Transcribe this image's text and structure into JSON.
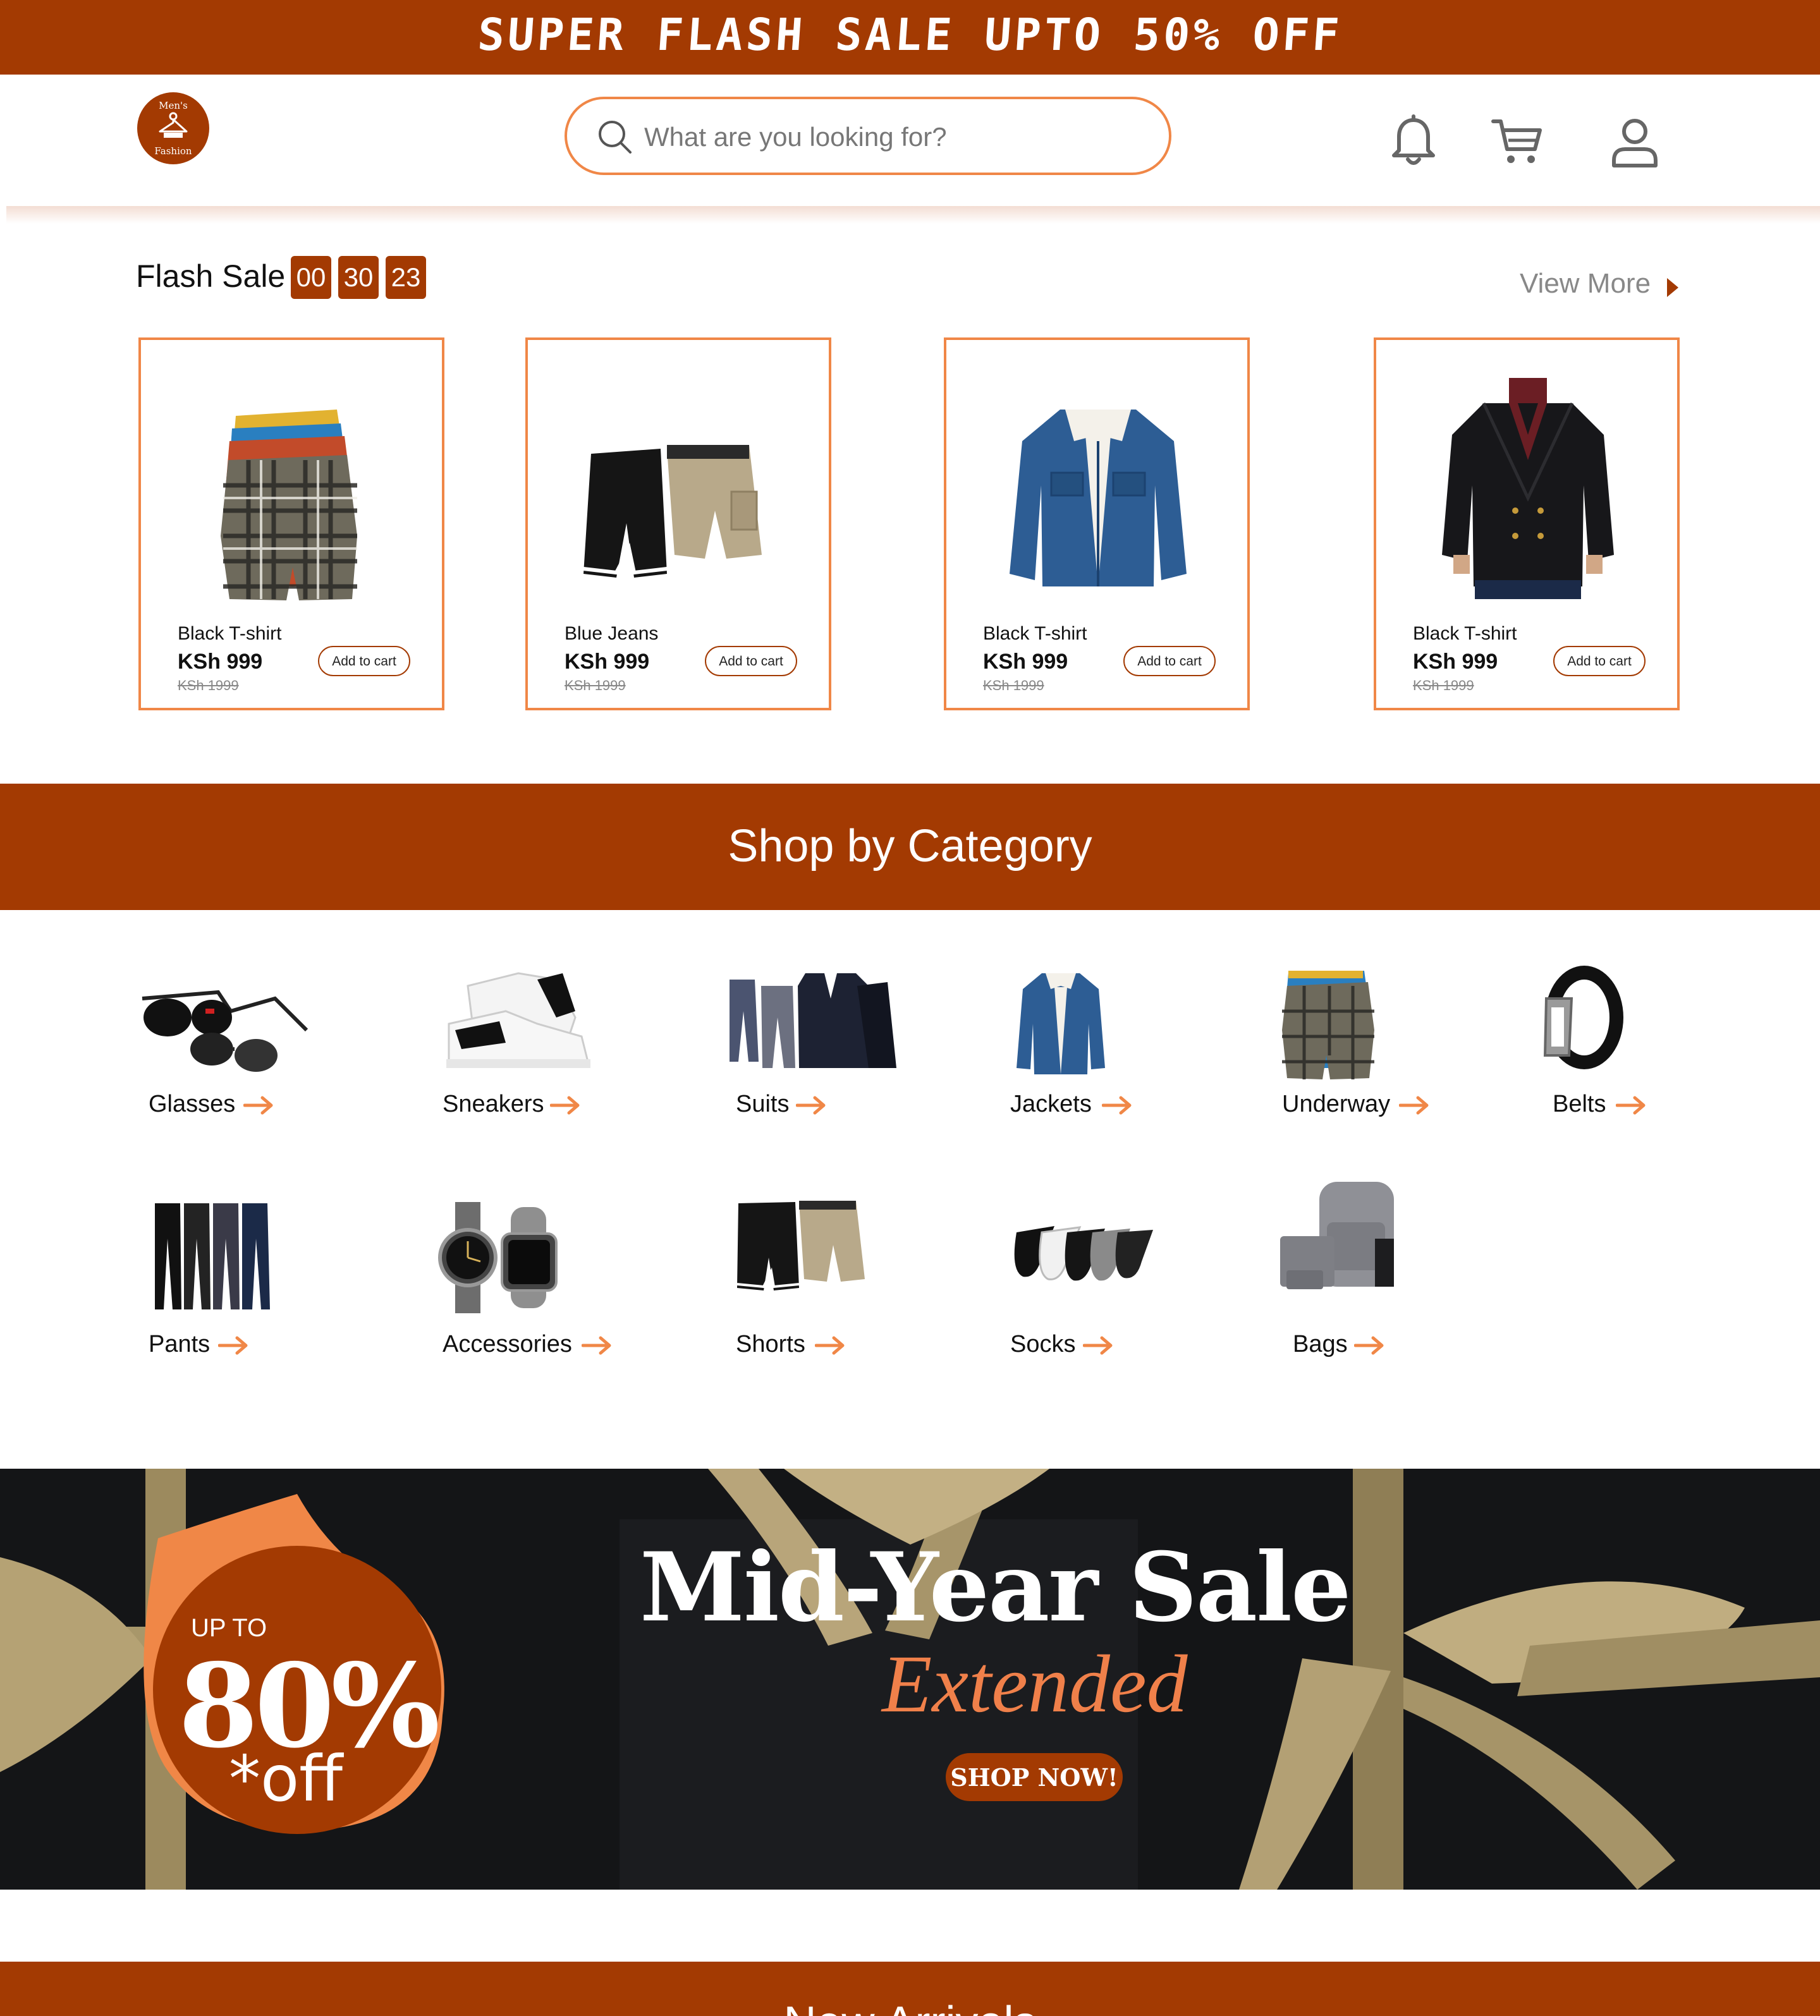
{
  "promo_bar": {
    "text": "SUPER FLASH SALE UPTO 50% OFF"
  },
  "logo": {
    "line1": "Men's",
    "line2": "Fashion"
  },
  "search": {
    "placeholder": "What are you looking for?"
  },
  "header_icons": [
    "bell-icon",
    "cart-icon",
    "user-icon"
  ],
  "flash_sale": {
    "title": "Flash Sale",
    "timer": {
      "hours": "00",
      "minutes": "30",
      "seconds": "23"
    },
    "view_more": "View More",
    "products": [
      {
        "name": "Black T-shirt",
        "price": "KSh 999",
        "old_price": "KSh 1999",
        "button": "Add to cart",
        "image": "plaid-boxers"
      },
      {
        "name": "Blue Jeans",
        "price": "KSh 999",
        "old_price": "KSh 1999",
        "button": "Add to cart",
        "image": "shorts"
      },
      {
        "name": "Black T-shirt",
        "price": "KSh 999",
        "old_price": "KSh 1999",
        "button": "Add to cart",
        "image": "denim-jacket"
      },
      {
        "name": "Black T-shirt",
        "price": "KSh 999",
        "old_price": "KSh 1999",
        "button": "Add to cart",
        "image": "black-blazer"
      }
    ]
  },
  "categories": {
    "title": "Shop by Category",
    "items": [
      {
        "label": "Glasses",
        "image": "sunglasses"
      },
      {
        "label": "Sneakers",
        "image": "sneakers"
      },
      {
        "label": "Suits",
        "image": "suits"
      },
      {
        "label": "Jackets",
        "image": "denim-jacket"
      },
      {
        "label": "Underway",
        "image": "plaid-boxers"
      },
      {
        "label": "Belts",
        "image": "belt"
      },
      {
        "label": "Pants",
        "image": "pants"
      },
      {
        "label": "Accessories",
        "image": "watches"
      },
      {
        "label": "Shorts",
        "image": "shorts"
      },
      {
        "label": "Socks",
        "image": "socks"
      },
      {
        "label": "Bags",
        "image": "backpack"
      }
    ]
  },
  "mid_year": {
    "badge_upto": "UP TO",
    "badge_percent": "80%",
    "badge_off": "*off",
    "title": "Mid-Year Sale",
    "subtitle": "Extended",
    "cta": "SHOP NOW!"
  },
  "new_arrivals": {
    "title": "New Arrivals"
  },
  "colors": {
    "brand": "#a33a02",
    "accent": "#f08747",
    "dark": "#111214",
    "ribbon": "#b8a57a"
  }
}
